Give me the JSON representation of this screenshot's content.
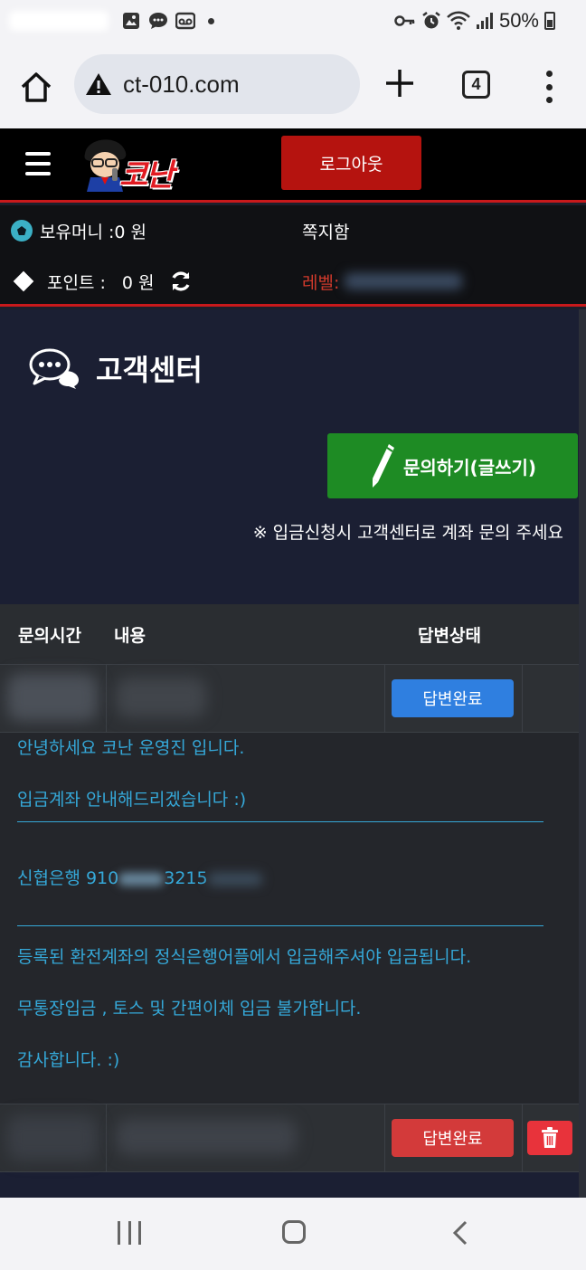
{
  "status_bar": {
    "battery": "50%"
  },
  "browser": {
    "url": "ct-010.com",
    "tab_count": "4"
  },
  "header": {
    "logo_text": "코난",
    "logout_label": "로그아웃"
  },
  "info": {
    "money_label": "보유머니 :0 원",
    "message_label": "쪽지함",
    "points_label": "포인트 :",
    "points_value": "0 원",
    "level_label": "레벨:"
  },
  "page": {
    "title": "고객센터",
    "write_button": "문의하기(글쓰기)",
    "notice": "※ 입금신청시 고객센터로 계좌 문의 주세요"
  },
  "table": {
    "headers": [
      "문의시간",
      "내용",
      "답변상태"
    ],
    "rows": [
      {
        "status": "답변완료",
        "status_color": "#2f7fe0"
      },
      {
        "status": "답변완료",
        "status_color": "#d33a3a"
      }
    ]
  },
  "answer": {
    "lines": [
      "안녕하세요 코난 운영진 입니다.",
      "입금계좌 안내해드리겠습니다 :)",
      "신협은행 910",
      "3215",
      "등록된 환전계좌의 정식은행어플에서 입금해주셔야 입금됩니다.",
      "무통장입금 , 토스 및 간편이체 입금 불가합니다.",
      "감사합니다. :)"
    ]
  },
  "colors": {
    "header_bg": "#000000",
    "accent_red": "#c8191b",
    "content_bg": "#1b1f33",
    "write_green": "#1e8b24",
    "answer_text": "#35a8d8"
  }
}
